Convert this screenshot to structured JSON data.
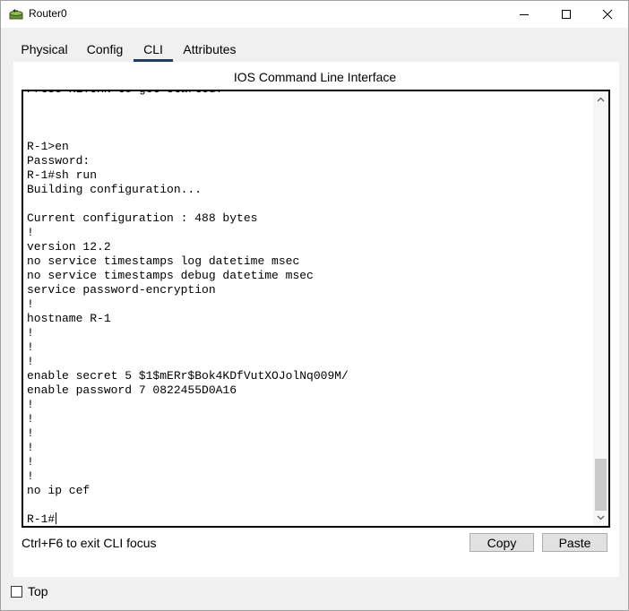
{
  "window": {
    "title": "Router0",
    "icon": "router-icon",
    "controls": [
      "minimize-icon",
      "maximize-icon",
      "close-icon"
    ]
  },
  "tabs": [
    {
      "label": "Physical",
      "active": false
    },
    {
      "label": "Config",
      "active": false
    },
    {
      "label": "CLI",
      "active": true
    },
    {
      "label": "Attributes",
      "active": false
    }
  ],
  "cli": {
    "panel_title": "IOS Command Line Interface",
    "lines": [
      "Press RETURN to get started!",
      "",
      "",
      "",
      "R-1>en",
      "Password:",
      "R-1#sh run",
      "Building configuration...",
      "",
      "Current configuration : 488 bytes",
      "!",
      "version 12.2",
      "no service timestamps log datetime msec",
      "no service timestamps debug datetime msec",
      "service password-encryption",
      "!",
      "hostname R-1",
      "!",
      "!",
      "!",
      "enable secret 5 $1$mERr$Bok4KDfVutXOJolNq009M/",
      "enable password 7 0822455D0A16",
      "!",
      "!",
      "!",
      "!",
      "!",
      "!",
      "no ip cef",
      "",
      "R-1#"
    ],
    "hint": "Ctrl+F6 to exit CLI focus",
    "copy_label": "Copy",
    "paste_label": "Paste"
  },
  "footer": {
    "top_label": "Top",
    "top_checked": false
  }
}
